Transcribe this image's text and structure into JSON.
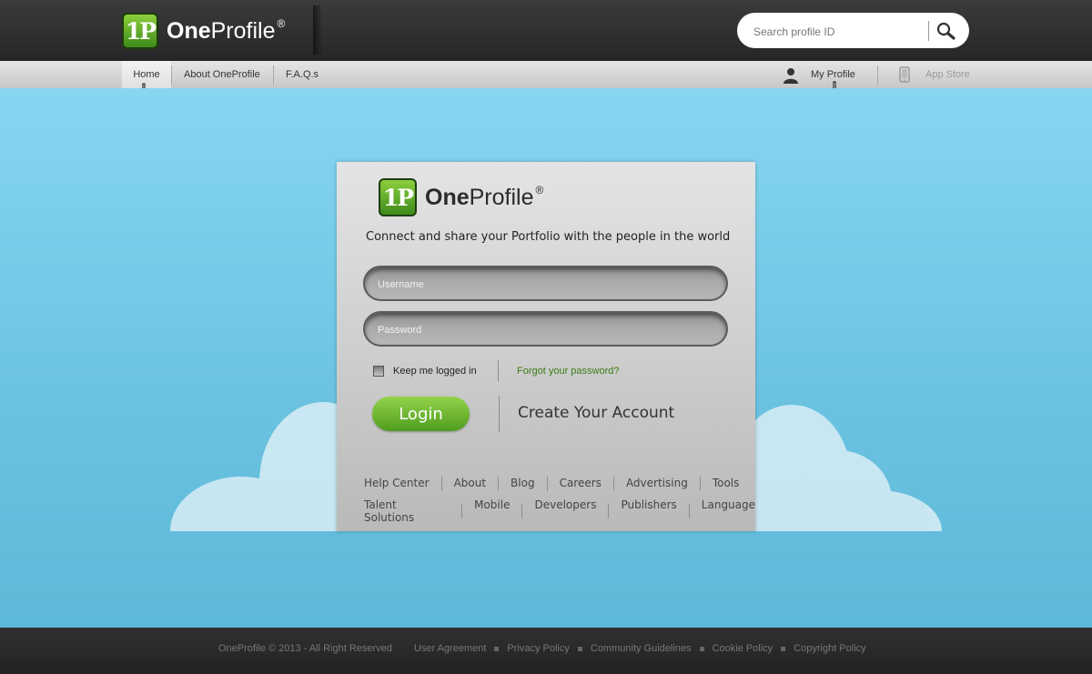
{
  "header": {
    "logo_mark": "1P",
    "logo_bold": "One",
    "logo_light": "Profile",
    "logo_reg": "®",
    "search_placeholder": "Search profile ID"
  },
  "nav": {
    "home": "Home",
    "about": "About OneProfile",
    "faq": "F.A.Q.s",
    "my_profile": "My Profile",
    "app_store": "App Store"
  },
  "login": {
    "tagline": "Connect and share your Portfolio with the people in the world",
    "username_placeholder": "Username",
    "password_placeholder": "Password",
    "keep_logged_in": "Keep me logged in",
    "forgot_password": "Forgot your password?",
    "login_button": "Login",
    "create_account": "Create Your Account"
  },
  "card_links": {
    "row1": [
      "Help Center",
      "About",
      "Blog",
      "Careers",
      "Advertising",
      "Tools"
    ],
    "row2": [
      "Talent Solutions",
      "Mobile",
      "Developers",
      "Publishers",
      "Language"
    ]
  },
  "footer": {
    "copyright": "OneProfile © 2013 - All Right Reserved",
    "links": [
      "User Agreement",
      "Privacy Policy",
      "Community Guidelines",
      "Cookie Policy",
      "Copyright Policy"
    ]
  },
  "colors": {
    "accent_green": "#5aa827",
    "sky_blue": "#6cc3e2",
    "header_dark": "#2e2e2e"
  }
}
